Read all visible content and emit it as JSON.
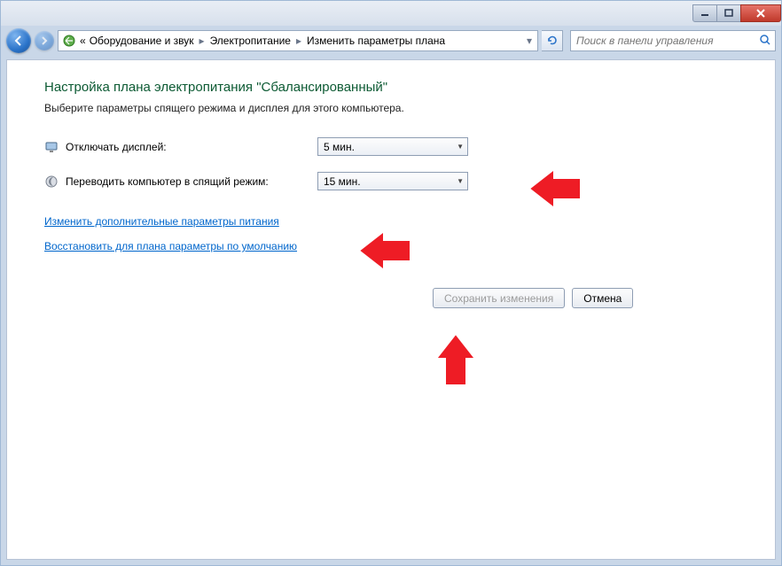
{
  "titlebar": {
    "text": ""
  },
  "breadcrumb": {
    "prefix": "«",
    "segments": [
      "Оборудование и звук",
      "Электропитание",
      "Изменить параметры плана"
    ]
  },
  "search": {
    "placeholder": "Поиск в панели управления"
  },
  "page": {
    "title": "Настройка плана электропитания \"Сбалансированный\"",
    "subtitle": "Выберите параметры спящего режима и дисплея для этого компьютера."
  },
  "settings": {
    "display_off": {
      "label": "Отключать дисплей:",
      "value": "5 мин."
    },
    "sleep": {
      "label": "Переводить компьютер в спящий режим:",
      "value": "15 мин."
    }
  },
  "links": {
    "advanced": "Изменить дополнительные параметры питания",
    "restore": "Восстановить для плана параметры по умолчанию"
  },
  "buttons": {
    "save": "Сохранить изменения",
    "cancel": "Отмена"
  }
}
